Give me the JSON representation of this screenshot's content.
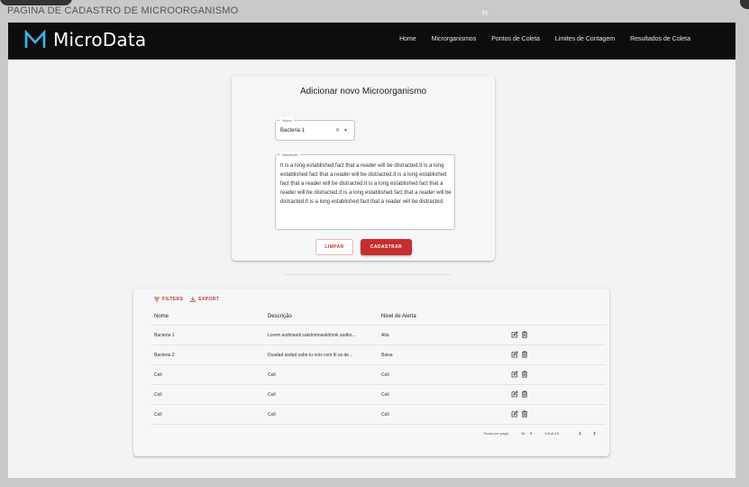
{
  "page_caption": "PAGINA DE CADASTRO DE MICROORGANISMO",
  "cursor_glyph": "H",
  "brand": {
    "name": "MicroData",
    "accent": "#38b6e8"
  },
  "nav": [
    {
      "label": "Home"
    },
    {
      "label": "Microrganismos"
    },
    {
      "label": "Pontos de Coleta"
    },
    {
      "label": "Limites de Contagem"
    },
    {
      "label": "Resultados de Coleta"
    }
  ],
  "form": {
    "title": "Adicionar novo Microorganismo",
    "name_label": "Nome",
    "name_value": "Bacteria 1",
    "clear_glyph": "✕",
    "dropdown_glyph": "▼",
    "desc_label": "Descrição",
    "desc_value": "It is a long established fact that a reader will be distracted.It is a long established fact that a reader will be distracted.It is a long established fact that a reader will be distracted.It is a long established fact that a reader will be distracted.It is a long established fact that a reader will be distracted.It is a long established fact that a reader will be distracted.",
    "clear_button": "LIMPAR",
    "submit_button": "CADASTRAR"
  },
  "table": {
    "filters_label": "FILTERS",
    "export_label": "EXPORT",
    "columns": [
      "Nome",
      "Descrição",
      "Nivel de Alerta"
    ],
    "rows": [
      {
        "nome": "Bacteria 1",
        "descricao": "Lorem asdmasdi sakdnmoaskdnmk asdkn...",
        "nivel": "Alta"
      },
      {
        "nome": "Bacteria 2",
        "descricao": "Dsadad asdad sabe tu nois com fil sa de...",
        "nivel": "Baixa"
      },
      {
        "nome": "Cell",
        "descricao": "Cell",
        "nivel": "Cell"
      },
      {
        "nome": "Cell",
        "descricao": "Cell",
        "nivel": "Cell"
      },
      {
        "nome": "Cell",
        "descricao": "Cell",
        "nivel": "Cell"
      }
    ],
    "pagination": {
      "rows_per_page_label": "Rows per page:",
      "rows_per_page_value": "10",
      "range": "1-5 of 13",
      "prev_glyph": "‹",
      "next_glyph": "›"
    }
  },
  "colors": {
    "appbar": "#0f0c0d",
    "primary": "#c62d2d",
    "background": "#f2f3f5"
  }
}
